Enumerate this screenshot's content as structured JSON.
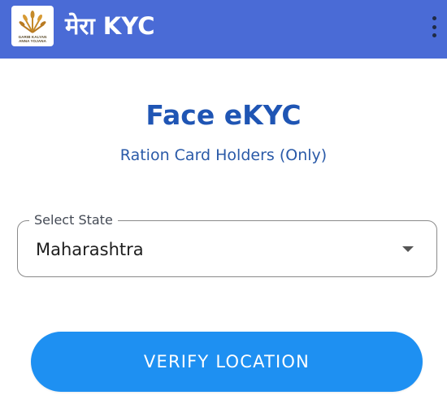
{
  "header": {
    "title": "मेरा KYC",
    "logo_text_line1": "GARIB KALYAN",
    "logo_text_line2": "ANNA YOJANA",
    "menu_icon": "more-vertical-icon"
  },
  "main": {
    "title": "Face eKYC",
    "subtitle": "Ration Card Holders (Only)",
    "state_select": {
      "label": "Select State",
      "value": "Maharashtra",
      "icon": "dropdown-arrow-icon"
    },
    "verify_button": {
      "label": "VERIFY LOCATION"
    }
  },
  "colors": {
    "appbar": "#4a6bd6",
    "title": "#1f55b4",
    "subtitle": "#2a5aa8",
    "button": "#1e90f2"
  }
}
